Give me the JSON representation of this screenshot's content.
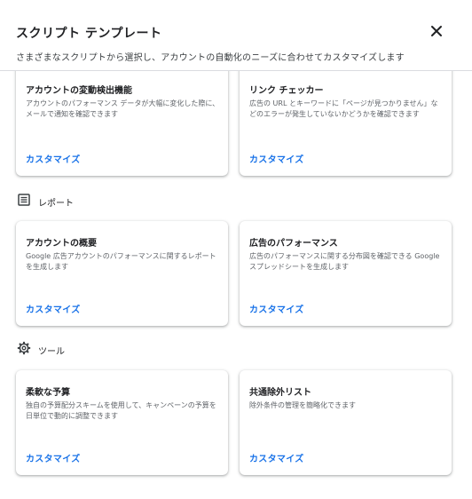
{
  "header": {
    "title": "スクリプト テンプレート",
    "subtitle": "さまざまなスクリプトから選択し、アカウントの自動化のニーズに合わせてカスタマイズします"
  },
  "sections": [
    {
      "label": "レポート",
      "icon": "report-icon"
    },
    {
      "label": "ツール",
      "icon": "gear-icon"
    }
  ],
  "cards": [
    {
      "title": "アカウントの変動検出機能",
      "desc": "アカウントのパフォーマンス データが大幅に変化した際に、メールで通知を確認できます",
      "link": "カスタマイズ"
    },
    {
      "title": "リンク チェッカー",
      "desc": "広告の URL とキーワードに「ページが見つかりません」などのエラーが発生していないかどうかを確認できます",
      "link": "カスタマイズ"
    },
    {
      "title": "アカウントの概要",
      "desc": "Google 広告アカウントのパフォーマンスに関するレポートを生成します",
      "link": "カスタマイズ"
    },
    {
      "title": "広告のパフォーマンス",
      "desc": "広告のパフォーマンスに関する分布図を確認できる Google スプレッドシートを生成します",
      "link": "カスタマイズ"
    },
    {
      "title": "柔軟な予算",
      "desc": "独自の予算配分スキームを使用して、キャンペーンの予算を日単位で動的に調整できます",
      "link": "カスタマイズ"
    },
    {
      "title": "共通除外リスト",
      "desc": "除外条件の管理を簡略化できます",
      "link": "カスタマイズ"
    }
  ],
  "colors": {
    "accent": "#1a73e8",
    "text": "#202124",
    "secondary": "#5f6368"
  }
}
